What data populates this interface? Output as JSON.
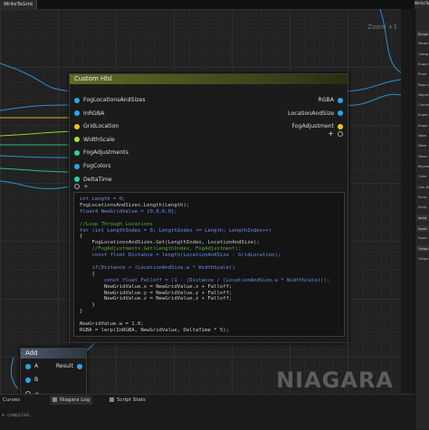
{
  "window": {
    "doc_tab": "WriteToGrid",
    "right_tab": "WriteToG"
  },
  "graph": {
    "zoom_label": "Zoom +1",
    "watermark": "NIAGARA"
  },
  "custom_hlsl": {
    "title": "Custom Hlsl",
    "inputs": [
      {
        "label": "FogLocationsAndSizes",
        "color": "#2aa6e6"
      },
      {
        "label": "InRGBA",
        "color": "#2aa6e6"
      },
      {
        "label": "GridLocation",
        "color": "#e8c42a"
      },
      {
        "label": "WidthScale",
        "color": "#9ee32a"
      },
      {
        "label": "FogAdjustments",
        "color": "#2ad4a0"
      },
      {
        "label": "FogColors",
        "color": "#2aa6e6"
      },
      {
        "label": "DeltaTime",
        "color": "#2ad4a0"
      }
    ],
    "outputs": [
      {
        "label": "RGBA",
        "color": "#2aa6e6"
      },
      {
        "label": "LocationAndSize",
        "color": "#2aa6e6"
      },
      {
        "label": "FogAdjustment",
        "color": "#e8c42a"
      }
    ],
    "code_lines": [
      "int Length = 0;",
      "FogLocationsAndSizes.Length(Length);",
      "float4 NewGridValue = {0,0,0,0};",
      "",
      "//Loop Through Locations",
      "for (int LengthIndex = 0; LengthIndex <= Length; LengthIndex++)",
      "{",
      "    FogLocationsAndSizes.Get(LengthIndex, LocationAndSize);",
      "    //FogAdjustments.Get(LengthIndex, FogAdjustment);",
      "    const float Distance = length(LocationAndSize - GridLocation);",
      "",
      "    if(Distance < (LocationAndSize.w * WidthScale))",
      "    {",
      "        const float Falloff = (1 - (Distance / (LocationAndSize.w * WidthScale)));",
      "        NewGridValue.x = NewGridValue.x + Falloff;",
      "        NewGridValue.y = NewGridValue.y + Falloff;",
      "        NewGridValue.z = NewGridValue.z + Falloff;",
      "    }",
      "}",
      "",
      "NewGridValue.w = 1.0;",
      "RGBA = lerp(InRGBA, NewGridValue, DeltaTime * 5);"
    ]
  },
  "add_node": {
    "title": "Add",
    "inputs": [
      "A",
      "B"
    ],
    "output": "Result"
  },
  "bottom": {
    "tabs": [
      "Curves",
      "Niagara Log",
      "Script Stats"
    ],
    "log_line": "e compiled."
  },
  "right_panel": {
    "rows": [
      "Script",
      "Modul",
      "Categ",
      "Suppr",
      "Provi",
      "Requi",
      "Depre",
      "Conve",
      "Exper",
      "Exper",
      "Note",
      "Note",
      "Descr",
      "Keywo",
      "Colle",
      "Can Al",
      "Scrip",
      "Scrip",
      "Valid",
      "Input",
      "Input",
      "Outpu",
      "Outpu"
    ]
  },
  "colors": {
    "node_title": "#5e6a25",
    "code_bg": "#141414",
    "graph_bg": "#222222"
  }
}
